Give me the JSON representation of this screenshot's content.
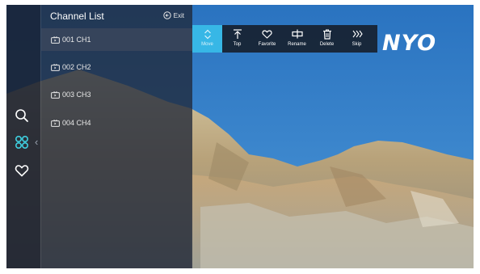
{
  "logo": {
    "text": "NYO"
  },
  "channel_panel": {
    "title": "Channel List",
    "exit_label": "Exit",
    "channels": [
      {
        "label": "001 CH1"
      },
      {
        "label": "002 CH2"
      },
      {
        "label": "003 CH3"
      },
      {
        "label": "004 CH4"
      }
    ]
  },
  "sidebar": {
    "icons": [
      "search-icon",
      "channel-list-icon",
      "favorite-icon"
    ]
  },
  "toolbar": {
    "items": [
      {
        "label": "Move",
        "icon": "move-icon"
      },
      {
        "label": "Top",
        "icon": "top-icon"
      },
      {
        "label": "Favorite",
        "icon": "heart-icon"
      },
      {
        "label": "Rename",
        "icon": "rename-icon"
      },
      {
        "label": "Delete",
        "icon": "trash-icon"
      },
      {
        "label": "Skip",
        "icon": "skip-icon"
      }
    ]
  },
  "colors": {
    "accent": "#37b7e6",
    "sky": "#2c77c4",
    "panel": "#202838"
  }
}
